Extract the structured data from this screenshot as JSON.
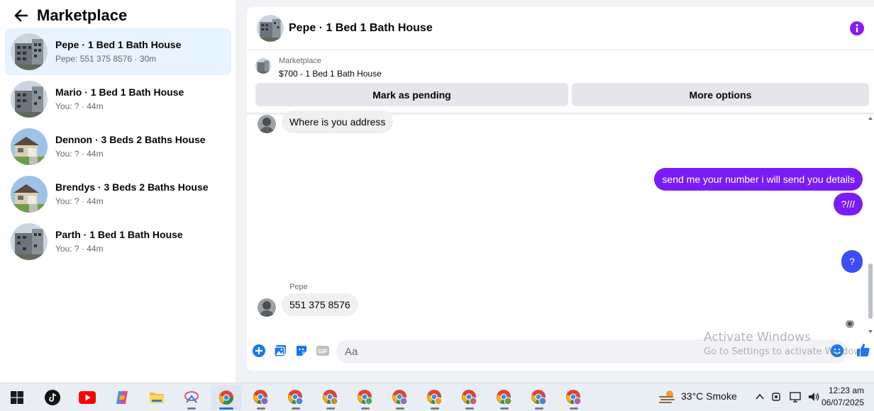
{
  "sidebar": {
    "title": "Marketplace",
    "conversations": [
      {
        "title": "Pepe · 1 Bed 1 Bath House",
        "subtitle": "Pepe: 551 375 8576 · 30m",
        "active": true
      },
      {
        "title": "Mario · 1 Bed 1 Bath House",
        "subtitle": "You: ? · 44m"
      },
      {
        "title": "Dennon · 3 Beds 2 Baths House",
        "subtitle": "You: ? · 44m"
      },
      {
        "title": "Brendys · 3 Beds 2 Baths House",
        "subtitle": "You: ? · 44m"
      },
      {
        "title": "Parth · 1 Bed 1 Bath House",
        "subtitle": "You: ? · 44m"
      }
    ]
  },
  "chat": {
    "header_title": "Pepe · 1 Bed 1 Bath House",
    "listing_source": "Marketplace",
    "listing_price": "$700 - 1 Bed 1 Bath House",
    "mark_pending_label": "Mark as pending",
    "more_options_label": "More options",
    "messages": [
      {
        "direction": "in",
        "text": "Where is you address"
      },
      {
        "direction": "out",
        "text": "send me your number i will send you details"
      },
      {
        "direction": "out",
        "text": "?///"
      },
      {
        "direction": "out",
        "text": "?"
      },
      {
        "direction": "in",
        "sender": "Pepe",
        "text": "551 375 8576"
      }
    ],
    "composer_placeholder": "Aa"
  },
  "watermark": {
    "title": "Activate Windows",
    "subtitle": "Go to Settings to activate Windows."
  },
  "taskbar": {
    "weather": "33°C  Smoke",
    "time": "12:23 am",
    "date": "06/07/2025"
  },
  "colors": {
    "accent": "#7a1cf5",
    "bubble_blue": "#3b4ef3",
    "active_row": "#e7f3ff",
    "messenger_blue": "#1877f2"
  }
}
